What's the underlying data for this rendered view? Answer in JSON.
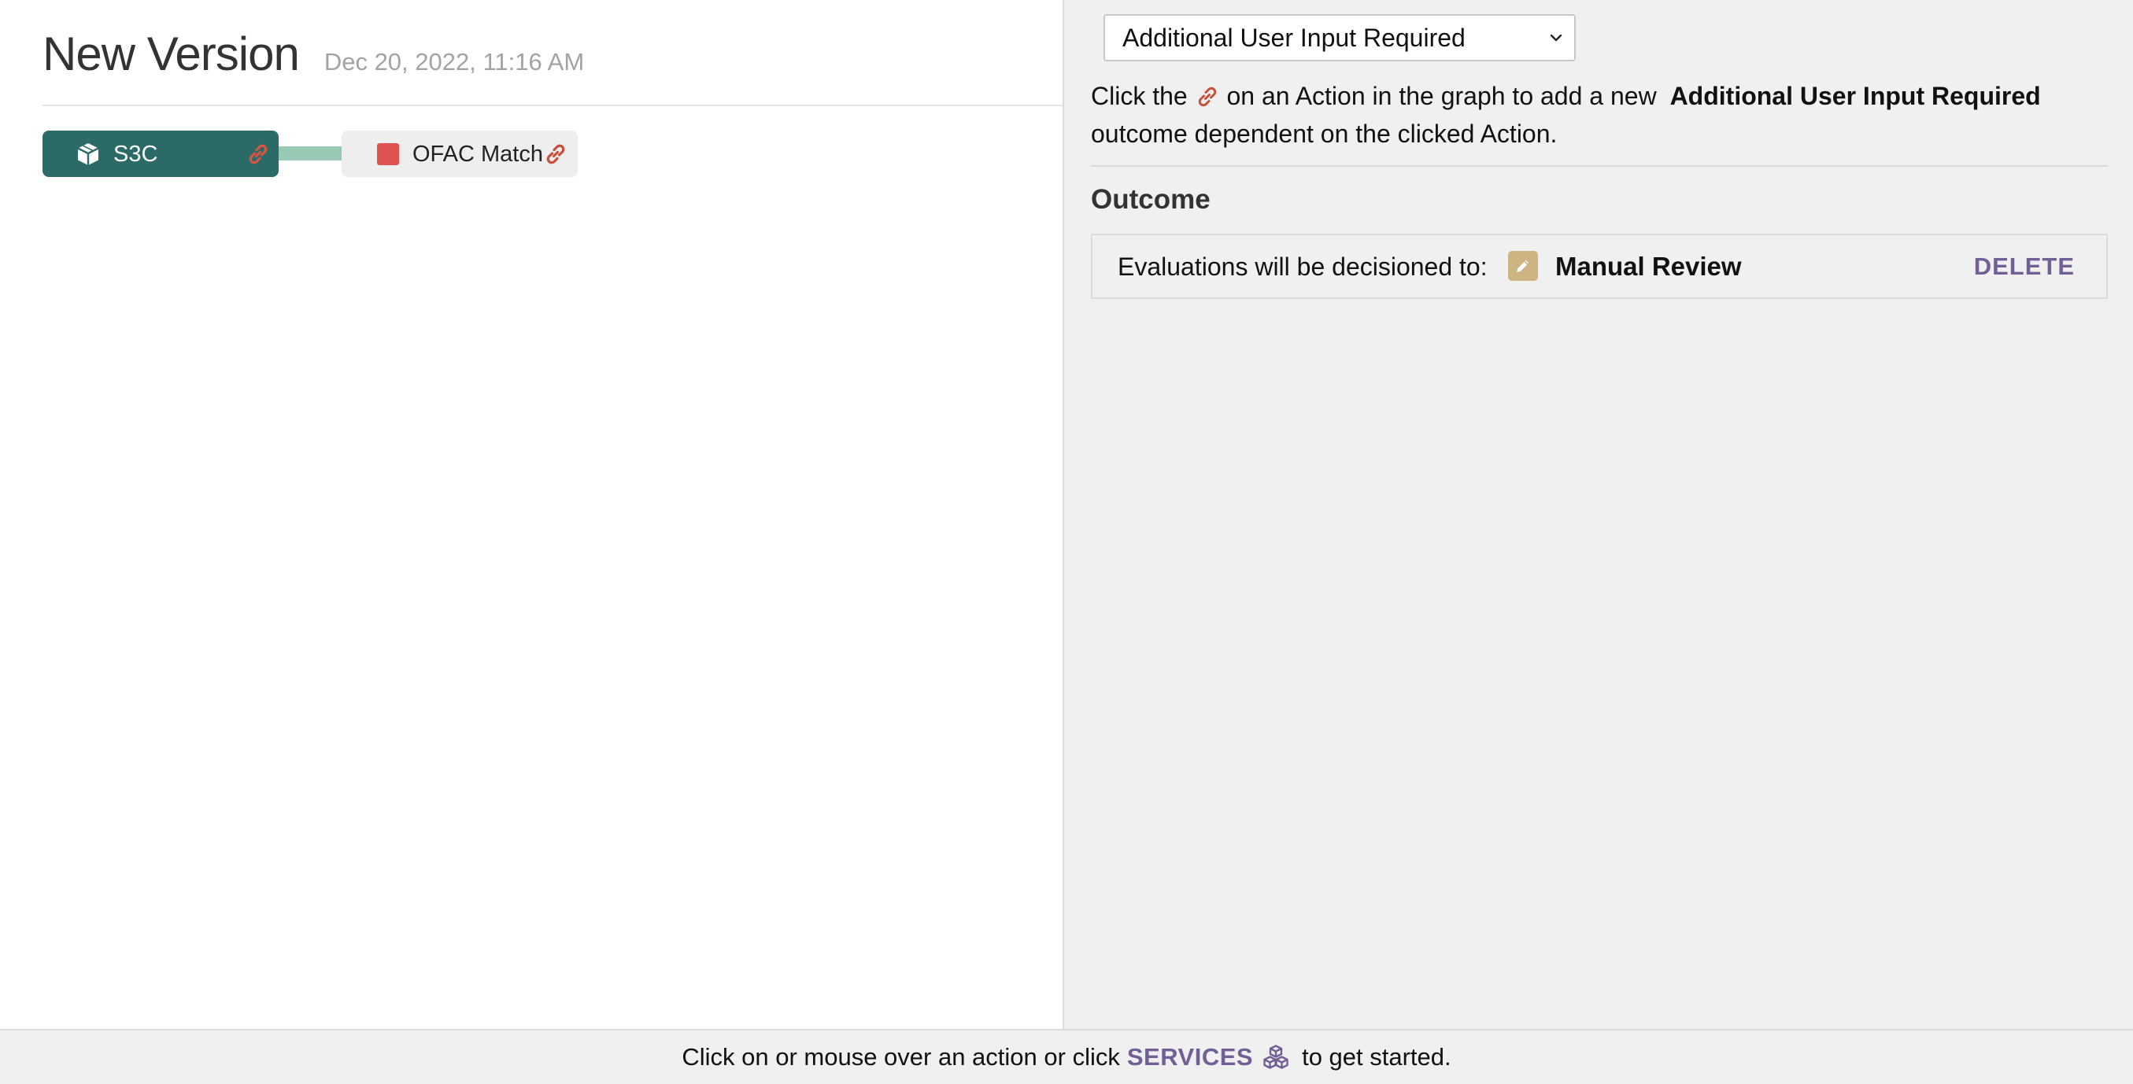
{
  "header": {
    "title": "New Version",
    "date": "Dec 20, 2022, 11:16 AM"
  },
  "graph": {
    "nodes": [
      {
        "label": "S3C",
        "icon": "cube-icon",
        "link_icon": "link-icon",
        "color": "#2b6a67"
      },
      {
        "label": "OFAC Match",
        "icon": "red-square-icon",
        "link_icon": "link-icon",
        "color": "#e05353"
      }
    ],
    "edge_color": "#97c9b4"
  },
  "panel": {
    "outcome_select": {
      "value": "Additional User Input Required",
      "options": [
        "Additional User Input Required"
      ]
    },
    "instruction": {
      "prefix": "Click the",
      "middle": "on an Action in the graph to add a new",
      "outcome_name": "Additional User Input Required",
      "suffix": "outcome dependent on the clicked Action."
    },
    "outcome_heading": "Outcome",
    "outcome_row": {
      "text": "Evaluations will be decisioned to:",
      "decision_icon": "pencil-icon",
      "decision": "Manual Review",
      "delete_label": "DELETE"
    }
  },
  "status_bar": {
    "prefix": "Click on or mouse over an action or click",
    "services_label": "SERVICES",
    "services_icon": "cubes-icon",
    "suffix": "to get started."
  },
  "colors": {
    "accent_purple": "#725f95",
    "link_red": "#c8503a",
    "decision_tan": "#cdb483"
  }
}
